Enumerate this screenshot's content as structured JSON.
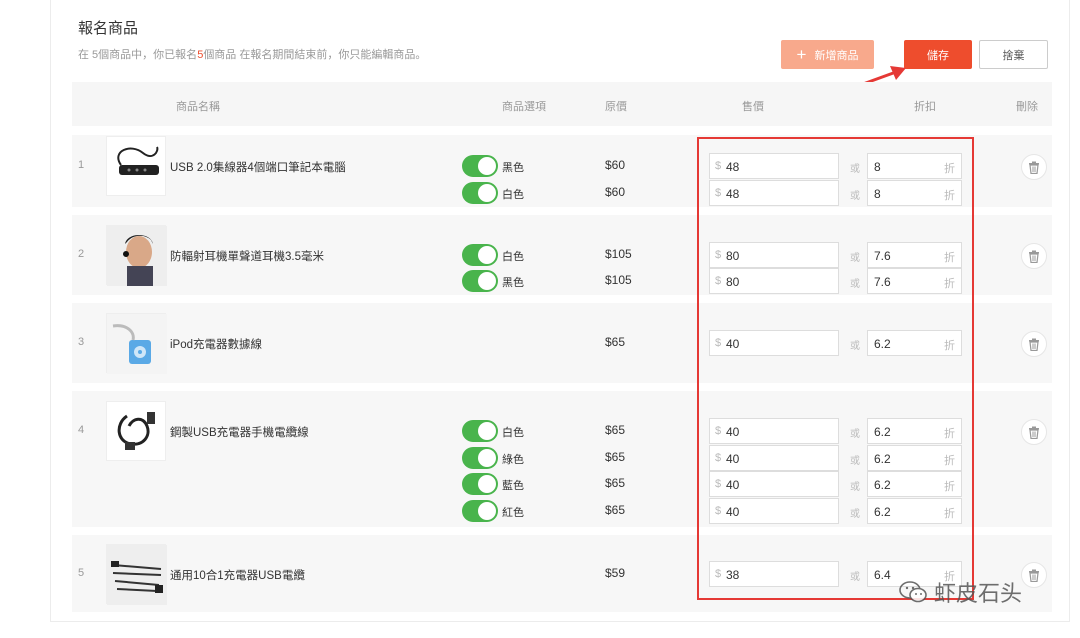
{
  "header": {
    "title": "報名商品",
    "subtitle_prefix": "在 5個商品中，你已報名",
    "subtitle_count": "5",
    "subtitle_suffix": "個商品  在報名期間結束前，你只能編輯商品。"
  },
  "toolbar": {
    "add_label": "新增商品",
    "save_label": "儲存",
    "cancel_label": "捨棄"
  },
  "columns": {
    "name": "商品名稱",
    "options": "商品選項",
    "original": "原價",
    "sale": "售價",
    "discount": "折扣",
    "delete": "刪除"
  },
  "labels": {
    "currency": "$",
    "or": "或",
    "discount_unit": "折"
  },
  "products": [
    {
      "num": "1",
      "name": "USB 2.0集線器4個端口筆記本電腦",
      "variants": [
        {
          "option": "黑色",
          "original": "$60",
          "price": "48",
          "discount": "8"
        },
        {
          "option": "白色",
          "original": "$60",
          "price": "48",
          "discount": "8"
        }
      ]
    },
    {
      "num": "2",
      "name": "防輻射耳機單聲道耳機3.5毫米",
      "variants": [
        {
          "option": "白色",
          "original": "$105",
          "price": "80",
          "discount": "7.6"
        },
        {
          "option": "黑色",
          "original": "$105",
          "price": "80",
          "discount": "7.6"
        }
      ]
    },
    {
      "num": "3",
      "name": "iPod充電器數據線",
      "variants": [
        {
          "option": "",
          "original": "$65",
          "price": "40",
          "discount": "6.2"
        }
      ]
    },
    {
      "num": "4",
      "name": "鋼製USB充電器手機電纜線",
      "variants": [
        {
          "option": "白色",
          "original": "$65",
          "price": "40",
          "discount": "6.2"
        },
        {
          "option": "綠色",
          "original": "$65",
          "price": "40",
          "discount": "6.2"
        },
        {
          "option": "藍色",
          "original": "$65",
          "price": "40",
          "discount": "6.2"
        },
        {
          "option": "紅色",
          "original": "$65",
          "price": "40",
          "discount": "6.2"
        }
      ]
    },
    {
      "num": "5",
      "name": "通用10合1充電器USB電纜",
      "variants": [
        {
          "option": "",
          "original": "$59",
          "price": "38",
          "discount": "6.4"
        }
      ]
    }
  ],
  "watermark": "虾皮石头",
  "colors": {
    "accent": "#ee4d2d",
    "toggle_on": "#49b44c",
    "highlight_box": "#e53935"
  }
}
